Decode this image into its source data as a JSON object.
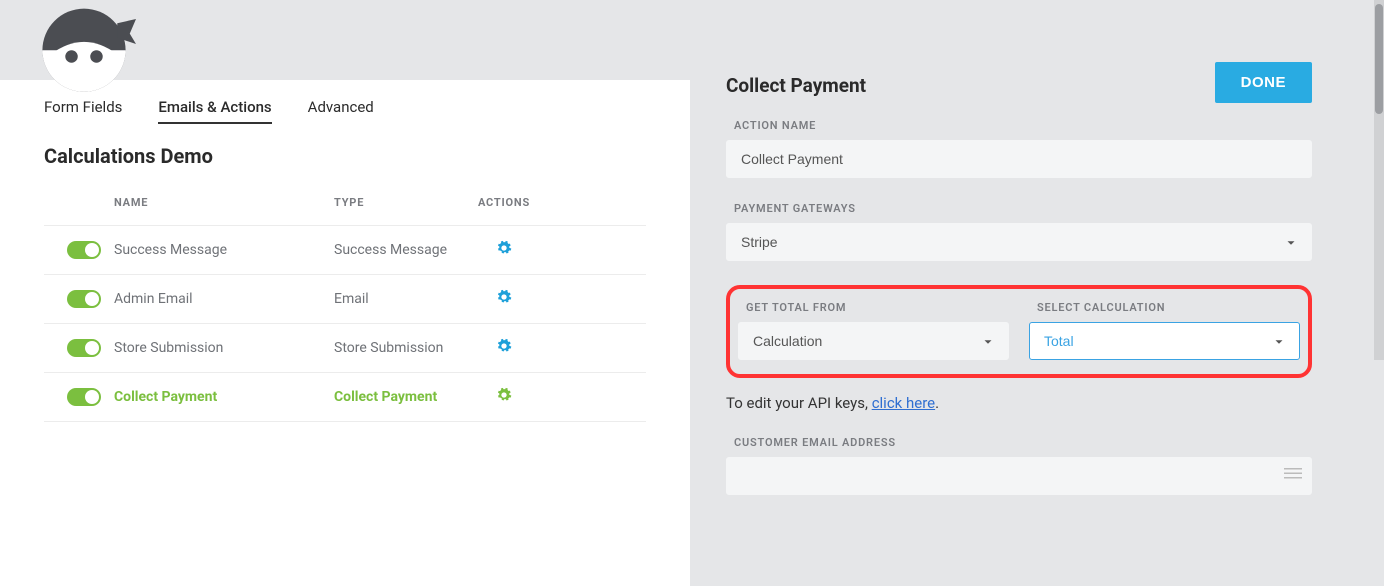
{
  "tabs": [
    "Form Fields",
    "Emails & Actions",
    "Advanced"
  ],
  "active_tab_index": 1,
  "page_title": "Calculations Demo",
  "table": {
    "headers": {
      "name": "NAME",
      "type": "TYPE",
      "actions": "ACTIONS"
    },
    "rows": [
      {
        "name": "Success Message",
        "type": "Success Message",
        "active": false
      },
      {
        "name": "Admin Email",
        "type": "Email",
        "active": false
      },
      {
        "name": "Store Submission",
        "type": "Store Submission",
        "active": false
      },
      {
        "name": "Collect Payment",
        "type": "Collect Payment",
        "active": true
      }
    ]
  },
  "done_label": "DONE",
  "panel_title": "Collect Payment",
  "fields": {
    "action_name": {
      "label": "ACTION NAME",
      "value": "Collect Payment"
    },
    "payment_gateways": {
      "label": "PAYMENT GATEWAYS",
      "value": "Stripe"
    },
    "get_total_from": {
      "label": "GET TOTAL FROM",
      "value": "Calculation"
    },
    "select_calculation": {
      "label": "SELECT CALCULATION",
      "value": "Total"
    },
    "customer_email": {
      "label": "CUSTOMER EMAIL ADDRESS",
      "value": ""
    }
  },
  "api_note": {
    "prefix": "To edit your API keys, ",
    "link": "click here",
    "suffix": "."
  }
}
